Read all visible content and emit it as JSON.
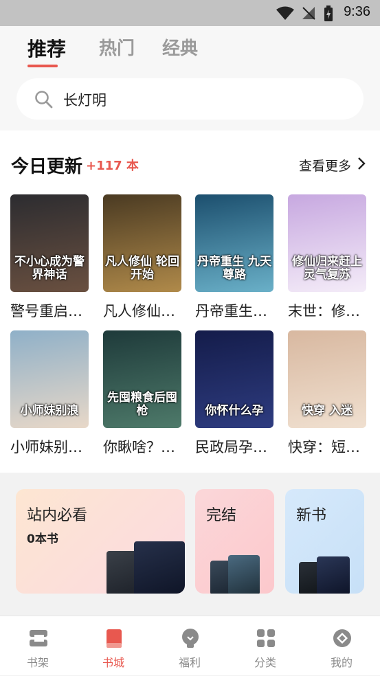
{
  "status_bar": {
    "time": "9:36"
  },
  "top_tabs": [
    {
      "label": "推荐",
      "active": true
    },
    {
      "label": "热门",
      "active": false
    },
    {
      "label": "经典",
      "active": false
    }
  ],
  "search": {
    "query": "长灯明"
  },
  "daily_updates": {
    "title": "今日更新",
    "count": "+117 本",
    "more": "查看更多",
    "books": [
      {
        "title": "警号重启…",
        "cover_text": "不小心成为警界神话",
        "colors": [
          "#2c2c30",
          "#6a5040"
        ]
      },
      {
        "title": "凡人修仙…",
        "cover_text": "凡人修仙 轮回开始",
        "colors": [
          "#4a3a22",
          "#b08a4a"
        ]
      },
      {
        "title": "丹帝重生…",
        "cover_text": "丹帝重生 九天尊路",
        "colors": [
          "#1c4f6e",
          "#6ab0c8"
        ]
      },
      {
        "title": "末世：修…",
        "cover_text": "修仙归来赶上灵气复苏",
        "colors": [
          "#c7a8e0",
          "#f4ecf8"
        ]
      },
      {
        "title": "小师妹别…",
        "cover_text": "小师妹别浪",
        "colors": [
          "#8fb0c8",
          "#e8d8c8"
        ]
      },
      {
        "title": "你瞅啥？…",
        "cover_text": "先囤粮食后囤枪",
        "colors": [
          "#1e3a3a",
          "#4e7a6a"
        ]
      },
      {
        "title": "民政局孕…",
        "cover_text": "你怀什么孕",
        "colors": [
          "#141c4a",
          "#2e3c80"
        ]
      },
      {
        "title": "快穿：短…",
        "cover_text": "快穿 入迷",
        "colors": [
          "#d8b8a0",
          "#f0e0d0"
        ]
      }
    ]
  },
  "lists": [
    {
      "title": "站内必看",
      "subtitle": "0本书",
      "colors": [
        "#fde6d2",
        "#fbd9e0"
      ]
    },
    {
      "title": "完结",
      "subtitle": "",
      "colors": [
        "#fbd7d9",
        "#fcc8cc"
      ]
    },
    {
      "title": "新书",
      "subtitle": "",
      "colors": [
        "#d6e9fb",
        "#c7e0f7"
      ]
    }
  ],
  "bottom_nav": [
    {
      "label": "书架",
      "icon": "bookshelf-icon",
      "active": false
    },
    {
      "label": "书城",
      "icon": "bookstore-icon",
      "active": true
    },
    {
      "label": "福利",
      "icon": "welfare-icon",
      "active": false
    },
    {
      "label": "分类",
      "icon": "category-icon",
      "active": false
    },
    {
      "label": "我的",
      "icon": "profile-icon",
      "active": false
    }
  ],
  "colors": {
    "accent": "#e8584f",
    "muted": "#8a8a8a"
  }
}
